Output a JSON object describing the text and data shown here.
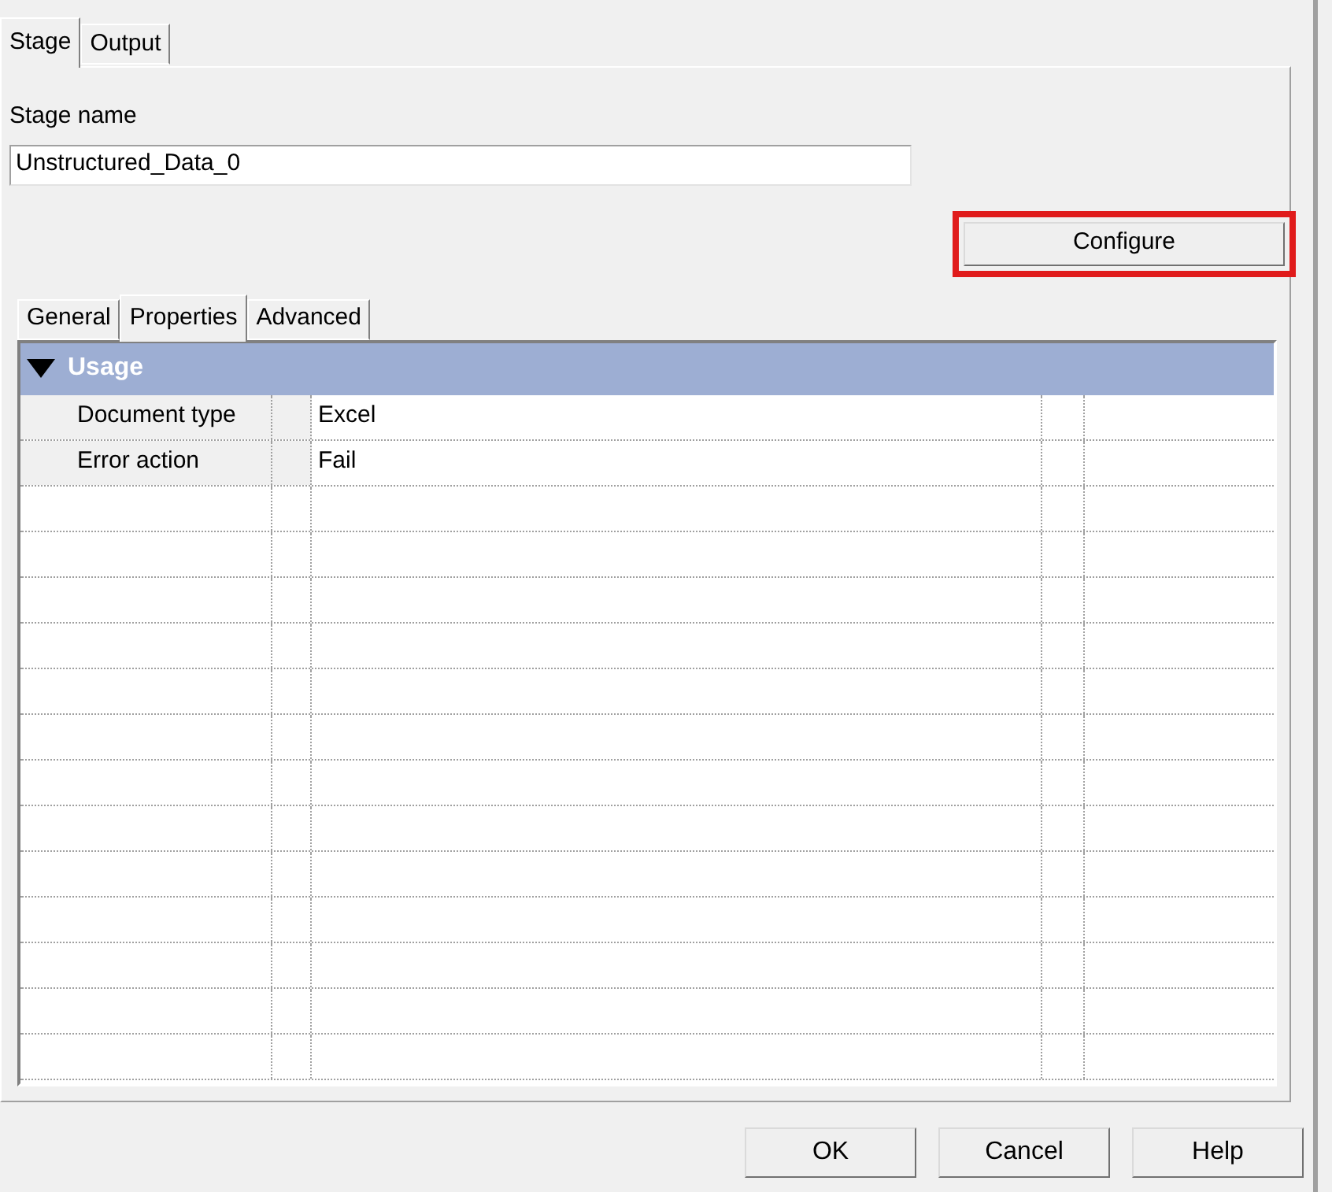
{
  "top_tabs": [
    {
      "label": "Stage",
      "selected": true
    },
    {
      "label": "Output",
      "selected": false
    }
  ],
  "stage_name": {
    "label": "Stage name",
    "value": "Unstructured_Data_0"
  },
  "configure_button": {
    "label": "Configure",
    "highlighted": true
  },
  "inner_tabs": [
    {
      "label": "General",
      "selected": false
    },
    {
      "label": "Properties",
      "selected": true
    },
    {
      "label": "Advanced",
      "selected": false
    }
  ],
  "property_grid": {
    "group": {
      "label": "Usage",
      "expanded": true
    },
    "rows": [
      {
        "name": "Document type",
        "value": "Excel"
      },
      {
        "name": "Error action",
        "value": "Fail"
      }
    ]
  },
  "buttons": [
    {
      "label": "OK"
    },
    {
      "label": "Cancel"
    },
    {
      "label": "Help"
    }
  ]
}
